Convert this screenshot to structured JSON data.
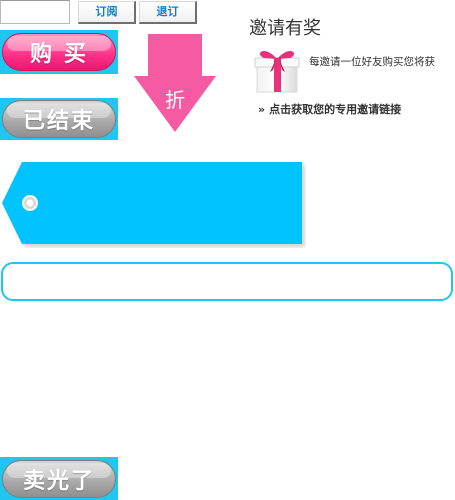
{
  "subscribe": {
    "email_value": "",
    "subscribe_label": "订阅",
    "unsubscribe_label": "退订"
  },
  "buttons": {
    "buy_label": "购 买",
    "ended_label": "已结束",
    "sold_out_label": "卖光了"
  },
  "discount": {
    "label": "折"
  },
  "invite": {
    "title": "邀请有奖",
    "description": "每邀请一位好友购买您将获",
    "link_arrow": "»",
    "link_label": "点击获取您的专用邀请链接"
  },
  "icons": {
    "gift": "gift-icon",
    "discount_arrow": "down-arrow-icon",
    "tag": "price-tag-icon"
  },
  "colors": {
    "accent_cyan": "#1ec6f0",
    "pink": "#ff2f87",
    "arrow_pink": "#f65aa2",
    "tag_blue": "#00c3ff",
    "link_blue": "#0a7fc4"
  }
}
